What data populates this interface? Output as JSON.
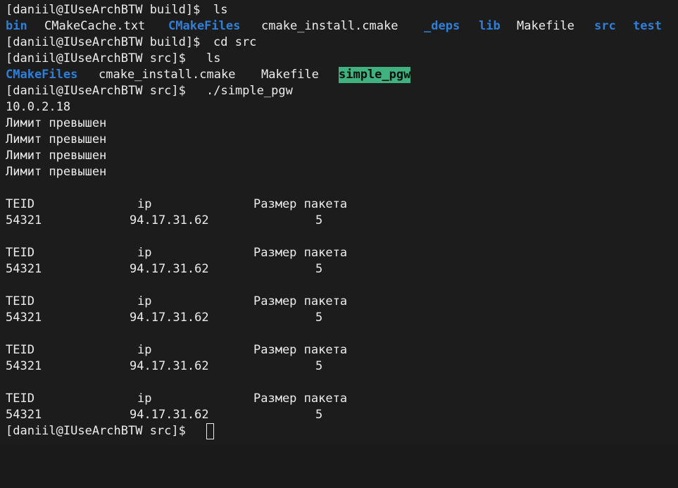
{
  "terminal": {
    "prompt_build": "[daniil@IUseArchBTW build]$",
    "prompt_src": "[daniil@IUseArchBTW src]$",
    "cmd_ls": "ls",
    "cmd_cd": "cd src",
    "cmd_run": "./simple_pgw",
    "ls_build": [
      {
        "name": "bin",
        "kind": "dir"
      },
      {
        "name": "CMakeCache.txt",
        "kind": "file"
      },
      {
        "name": "CMakeFiles",
        "kind": "dir"
      },
      {
        "name": "cmake_install.cmake",
        "kind": "file"
      },
      {
        "name": "_deps",
        "kind": "dir"
      },
      {
        "name": "lib",
        "kind": "dir"
      },
      {
        "name": "Makefile",
        "kind": "file"
      },
      {
        "name": "src",
        "kind": "dir"
      },
      {
        "name": "test",
        "kind": "dir"
      }
    ],
    "ls_src": [
      {
        "name": "CMakeFiles",
        "kind": "dir"
      },
      {
        "name": "cmake_install.cmake",
        "kind": "file"
      },
      {
        "name": "Makefile",
        "kind": "file"
      },
      {
        "name": "simple_pgw",
        "kind": "exe"
      }
    ],
    "output_ip": "10.0.2.18",
    "limit_message": "Лимит превышен",
    "table_header": {
      "teid": "TEID",
      "ip": "ip",
      "size": "Размер пакета"
    },
    "table_row": {
      "teid": "54321",
      "ip": "94.17.31.62",
      "size": "5"
    }
  },
  "colors": {
    "background": "#1c1c1c",
    "foreground": "#ececec",
    "directory": "#2f7fd8",
    "executable_bg": "#3fb27f"
  }
}
